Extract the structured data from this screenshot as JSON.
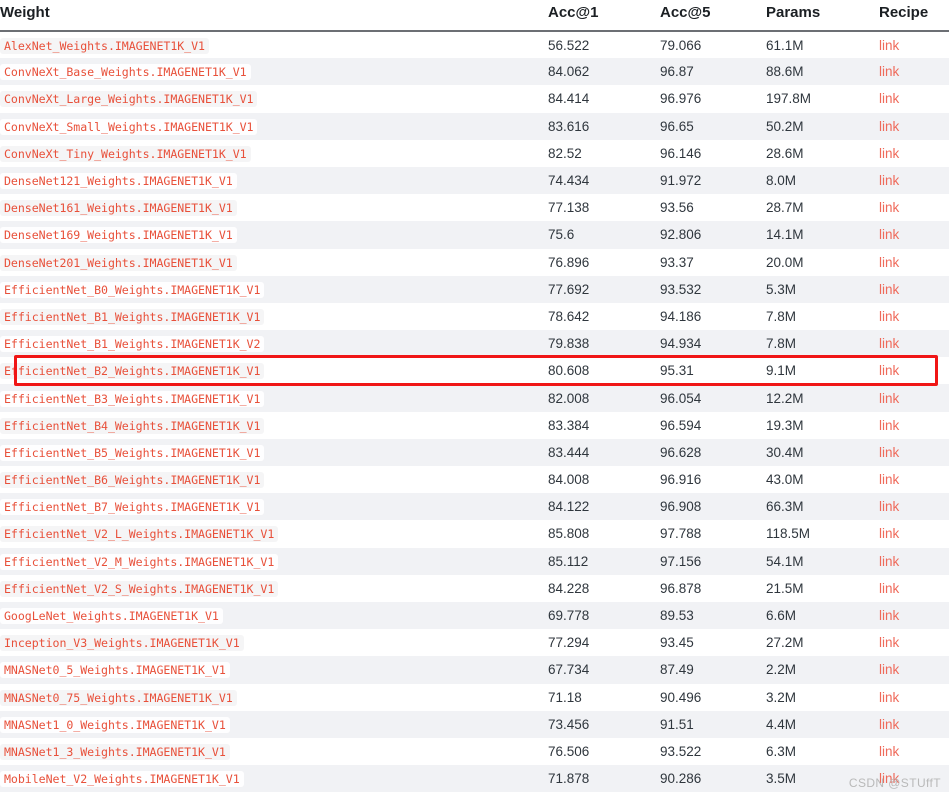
{
  "table": {
    "columns": [
      {
        "key": "weight",
        "label": "Weight"
      },
      {
        "key": "acc1",
        "label": "Acc@1"
      },
      {
        "key": "acc5",
        "label": "Acc@5"
      },
      {
        "key": "params",
        "label": "Params"
      },
      {
        "key": "recipe",
        "label": "Recipe"
      }
    ],
    "recipe_link_label": "link",
    "rows": [
      {
        "weight": "AlexNet_Weights.IMAGENET1K_V1",
        "acc1": "56.522",
        "acc5": "79.066",
        "params": "61.1M",
        "recipe": "link"
      },
      {
        "weight": "ConvNeXt_Base_Weights.IMAGENET1K_V1",
        "acc1": "84.062",
        "acc5": "96.87",
        "params": "88.6M",
        "recipe": "link"
      },
      {
        "weight": "ConvNeXt_Large_Weights.IMAGENET1K_V1",
        "acc1": "84.414",
        "acc5": "96.976",
        "params": "197.8M",
        "recipe": "link"
      },
      {
        "weight": "ConvNeXt_Small_Weights.IMAGENET1K_V1",
        "acc1": "83.616",
        "acc5": "96.65",
        "params": "50.2M",
        "recipe": "link"
      },
      {
        "weight": "ConvNeXt_Tiny_Weights.IMAGENET1K_V1",
        "acc1": "82.52",
        "acc5": "96.146",
        "params": "28.6M",
        "recipe": "link"
      },
      {
        "weight": "DenseNet121_Weights.IMAGENET1K_V1",
        "acc1": "74.434",
        "acc5": "91.972",
        "params": "8.0M",
        "recipe": "link"
      },
      {
        "weight": "DenseNet161_Weights.IMAGENET1K_V1",
        "acc1": "77.138",
        "acc5": "93.56",
        "params": "28.7M",
        "recipe": "link"
      },
      {
        "weight": "DenseNet169_Weights.IMAGENET1K_V1",
        "acc1": "75.6",
        "acc5": "92.806",
        "params": "14.1M",
        "recipe": "link"
      },
      {
        "weight": "DenseNet201_Weights.IMAGENET1K_V1",
        "acc1": "76.896",
        "acc5": "93.37",
        "params": "20.0M",
        "recipe": "link"
      },
      {
        "weight": "EfficientNet_B0_Weights.IMAGENET1K_V1",
        "acc1": "77.692",
        "acc5": "93.532",
        "params": "5.3M",
        "recipe": "link"
      },
      {
        "weight": "EfficientNet_B1_Weights.IMAGENET1K_V1",
        "acc1": "78.642",
        "acc5": "94.186",
        "params": "7.8M",
        "recipe": "link"
      },
      {
        "weight": "EfficientNet_B1_Weights.IMAGENET1K_V2",
        "acc1": "79.838",
        "acc5": "94.934",
        "params": "7.8M",
        "recipe": "link"
      },
      {
        "weight": "EfficientNet_B2_Weights.IMAGENET1K_V1",
        "acc1": "80.608",
        "acc5": "95.31",
        "params": "9.1M",
        "recipe": "link"
      },
      {
        "weight": "EfficientNet_B3_Weights.IMAGENET1K_V1",
        "acc1": "82.008",
        "acc5": "96.054",
        "params": "12.2M",
        "recipe": "link"
      },
      {
        "weight": "EfficientNet_B4_Weights.IMAGENET1K_V1",
        "acc1": "83.384",
        "acc5": "96.594",
        "params": "19.3M",
        "recipe": "link"
      },
      {
        "weight": "EfficientNet_B5_Weights.IMAGENET1K_V1",
        "acc1": "83.444",
        "acc5": "96.628",
        "params": "30.4M",
        "recipe": "link"
      },
      {
        "weight": "EfficientNet_B6_Weights.IMAGENET1K_V1",
        "acc1": "84.008",
        "acc5": "96.916",
        "params": "43.0M",
        "recipe": "link"
      },
      {
        "weight": "EfficientNet_B7_Weights.IMAGENET1K_V1",
        "acc1": "84.122",
        "acc5": "96.908",
        "params": "66.3M",
        "recipe": "link"
      },
      {
        "weight": "EfficientNet_V2_L_Weights.IMAGENET1K_V1",
        "acc1": "85.808",
        "acc5": "97.788",
        "params": "118.5M",
        "recipe": "link"
      },
      {
        "weight": "EfficientNet_V2_M_Weights.IMAGENET1K_V1",
        "acc1": "85.112",
        "acc5": "97.156",
        "params": "54.1M",
        "recipe": "link"
      },
      {
        "weight": "EfficientNet_V2_S_Weights.IMAGENET1K_V1",
        "acc1": "84.228",
        "acc5": "96.878",
        "params": "21.5M",
        "recipe": "link"
      },
      {
        "weight": "GoogLeNet_Weights.IMAGENET1K_V1",
        "acc1": "69.778",
        "acc5": "89.53",
        "params": "6.6M",
        "recipe": "link"
      },
      {
        "weight": "Inception_V3_Weights.IMAGENET1K_V1",
        "acc1": "77.294",
        "acc5": "93.45",
        "params": "27.2M",
        "recipe": "link"
      },
      {
        "weight": "MNASNet0_5_Weights.IMAGENET1K_V1",
        "acc1": "67.734",
        "acc5": "87.49",
        "params": "2.2M",
        "recipe": "link"
      },
      {
        "weight": "MNASNet0_75_Weights.IMAGENET1K_V1",
        "acc1": "71.18",
        "acc5": "90.496",
        "params": "3.2M",
        "recipe": "link"
      },
      {
        "weight": "MNASNet1_0_Weights.IMAGENET1K_V1",
        "acc1": "73.456",
        "acc5": "91.51",
        "params": "4.4M",
        "recipe": "link"
      },
      {
        "weight": "MNASNet1_3_Weights.IMAGENET1K_V1",
        "acc1": "76.506",
        "acc5": "93.522",
        "params": "6.3M",
        "recipe": "link"
      },
      {
        "weight": "MobileNet_V2_Weights.IMAGENET1K_V1",
        "acc1": "71.878",
        "acc5": "90.286",
        "params": "3.5M",
        "recipe": "link"
      }
    ]
  },
  "annotation": {
    "highlighted_row_index": 12,
    "highlighted_row_weight": "EfficientNet_B2_Weights.IMAGENET1K_V1",
    "box_color": "#f01616"
  },
  "watermark": {
    "text": "CSDN @STUffT"
  },
  "colors": {
    "code_text": "#e8503a",
    "link": "#ef6a5a",
    "header_text": "#1b1f23",
    "row_stripe": "#f1f2f5",
    "value_text": "#2f363d",
    "header_rule": "#6c6f74"
  }
}
